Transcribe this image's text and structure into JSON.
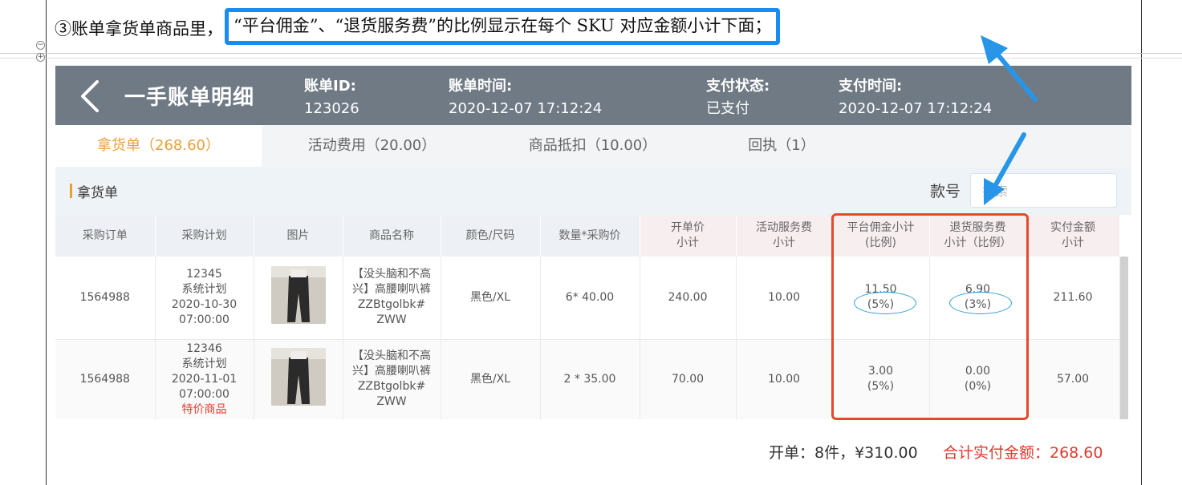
{
  "instruction": {
    "prefix": "③账单拿货单商品里，",
    "highlight": "“平台佣金”、“退货服务费”的比例显示在每个 SKU 对应金额小计下面；"
  },
  "header": {
    "title": "一手账单明细",
    "bill_id_label": "账单ID:",
    "bill_id": "123026",
    "bill_time_label": "账单时间:",
    "bill_time": "2020-12-07 17:12:24",
    "pay_status_label": "支付状态:",
    "pay_status": "已支付",
    "pay_time_label": "支付时间:",
    "pay_time": "2020-12-07 17:12:24"
  },
  "tabs": [
    {
      "label": "拿货单（268.60）"
    },
    {
      "label": "活动费用（20.00）"
    },
    {
      "label": "商品抵扣（10.00）"
    },
    {
      "label": "回执（1）"
    }
  ],
  "section": {
    "name": "拿货单",
    "style_label": "款号",
    "style_placeholder": "搜索"
  },
  "columns": [
    "采购订单",
    "采购计划",
    "图片",
    "商品名称",
    "颜色/尺码",
    "数量*采购价",
    "开单价\n小计",
    "活动服务费\n小计",
    "平台佣金小计\n(比例)",
    "退货服务费\n小计（比例）",
    "实付金额\n小计"
  ],
  "rows": [
    {
      "order": "1564988",
      "plan_id": "12345",
      "plan_type": "系统计划",
      "plan_date": "2020-10-30",
      "plan_time": "07:00:00",
      "plan_tag": "",
      "product": "【没头脑和不高兴】高腰喇叭裤ZZBtgolbk# ZWW",
      "color_size": "黑色/XL",
      "qty_price": "6* 40.00",
      "open_subtotal": "240.00",
      "activity_fee": "10.00",
      "commission": "11.50",
      "commission_ratio": "(5%)",
      "return_fee": "6.90",
      "return_ratio": "(3%)",
      "paid": "211.60"
    },
    {
      "order": "1564988",
      "plan_id": "12346",
      "plan_type": "系统计划",
      "plan_date": "2020-11-01",
      "plan_time": "07:00:00",
      "plan_tag": "特价商品",
      "product": "【没头脑和不高兴】高腰喇叭裤ZZBtgolbk# ZWW",
      "color_size": "黑色/XL",
      "qty_price": "2 * 35.00",
      "open_subtotal": "70.00",
      "activity_fee": "10.00",
      "commission": "3.00",
      "commission_ratio": "(5%)",
      "return_fee": "0.00",
      "return_ratio": "(0%)",
      "paid": "57.00"
    }
  ],
  "footer": {
    "count": "开单：8件，¥310.00",
    "total": "合计实付金额：268.60"
  },
  "colors": {
    "header_bg": "#6f7a85",
    "active_tab": "#e8a13a",
    "highlight_box": "#1a8cf0",
    "annotation_box": "#e5492c",
    "total_red": "#e23a2f"
  }
}
